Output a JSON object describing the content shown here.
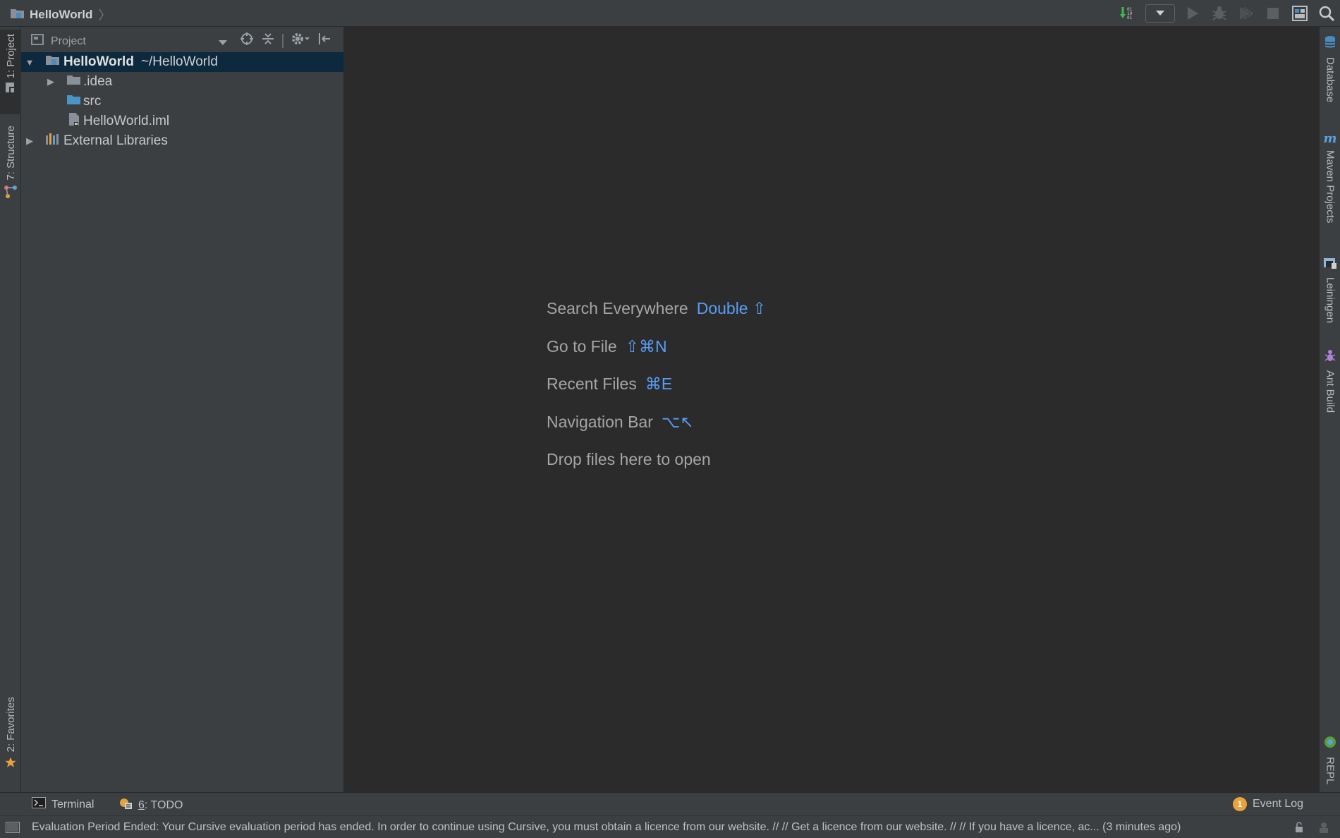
{
  "window": {
    "breadcrumb": "HelloWorld"
  },
  "toolbar": {
    "icons": [
      "build-icon",
      "run-config-dropdown",
      "run-icon",
      "debug-icon",
      "coverage-icon",
      "stop-icon",
      "project-structure-icon",
      "search-icon"
    ]
  },
  "left_strip": {
    "tabs": [
      {
        "label": "1: Project",
        "icon": "project-icon"
      },
      {
        "label": "7: Structure",
        "icon": "structure-icon"
      },
      {
        "label": "2: Favorites",
        "icon": "star-icon"
      }
    ]
  },
  "right_strip": {
    "tabs": [
      {
        "label": "Database",
        "icon": "database-icon"
      },
      {
        "label": "Maven Projects",
        "icon": "maven-icon"
      },
      {
        "label": "Leiningen",
        "icon": "leiningen-icon"
      },
      {
        "label": "Ant Build",
        "icon": "ant-icon"
      },
      {
        "label": "REPL",
        "icon": "repl-icon"
      }
    ]
  },
  "project_panel": {
    "title": "Project",
    "tree": [
      {
        "name": "HelloWorld",
        "path": "~/HelloWorld",
        "type": "module",
        "expanded": true,
        "selected": true
      },
      {
        "name": ".idea",
        "type": "folder",
        "expanded": false
      },
      {
        "name": "src",
        "type": "source-folder"
      },
      {
        "name": "HelloWorld.iml",
        "type": "iml-file"
      },
      {
        "name": "External Libraries",
        "type": "libraries",
        "expanded": false
      }
    ]
  },
  "editor": {
    "hints": [
      {
        "label": "Search Everywhere",
        "shortcut": "Double ⇧"
      },
      {
        "label": "Go to File",
        "shortcut": "⇧⌘N"
      },
      {
        "label": "Recent Files",
        "shortcut": "⌘E"
      },
      {
        "label": "Navigation Bar",
        "shortcut": "⌥↖"
      },
      {
        "label": "Drop files here to open",
        "shortcut": ""
      }
    ]
  },
  "bottom_tabs": {
    "terminal": "Terminal",
    "todo_mnemonic": "6",
    "todo_rest": ": TODO",
    "event_log": "Event Log",
    "event_count": "1"
  },
  "status": {
    "message": "Evaluation Period Ended: Your Cursive evaluation period has ended. In order to continue using Cursive, you must obtain a licence from our website. // // Get a licence from our website. // // If you have a licence, ac... (3 minutes ago)"
  },
  "colors": {
    "accent": "#589df6",
    "selection": "#0d293e",
    "panel": "#3c3f41",
    "editor_bg": "#2b2b2b"
  }
}
